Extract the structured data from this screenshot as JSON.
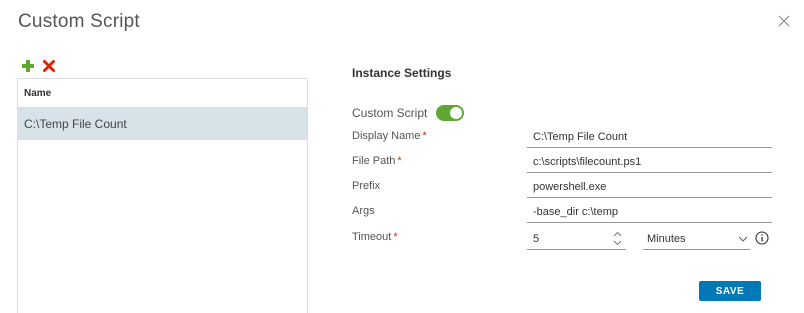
{
  "dialog": {
    "title": "Custom Script"
  },
  "toolbar": {
    "add_icon": "plus-icon",
    "delete_icon": "x-icon",
    "add_color": "#5ea832",
    "delete_color": "#e12200"
  },
  "list": {
    "header": "Name",
    "items": [
      {
        "label": "C:\\Temp File Count",
        "selected": true
      }
    ]
  },
  "settings": {
    "section_title": "Instance Settings",
    "toggle_label": "Custom Script",
    "toggle_on": true,
    "toggle_color": "#5ea832",
    "fields": {
      "display_name": {
        "label": "Display Name",
        "required": true,
        "value": "C:\\Temp File Count"
      },
      "file_path": {
        "label": "File Path",
        "required": true,
        "value": "c:\\scripts\\filecount.ps1"
      },
      "prefix": {
        "label": "Prefix",
        "required": false,
        "value": "powershell.exe"
      },
      "args": {
        "label": "Args",
        "required": false,
        "value": "-base_dir c:\\temp"
      },
      "timeout": {
        "label": "Timeout",
        "required": true,
        "value": "5",
        "unit": "Minutes"
      }
    },
    "required_marker": "*"
  },
  "actions": {
    "save_label": "SAVE",
    "save_color": "#0079b8"
  }
}
